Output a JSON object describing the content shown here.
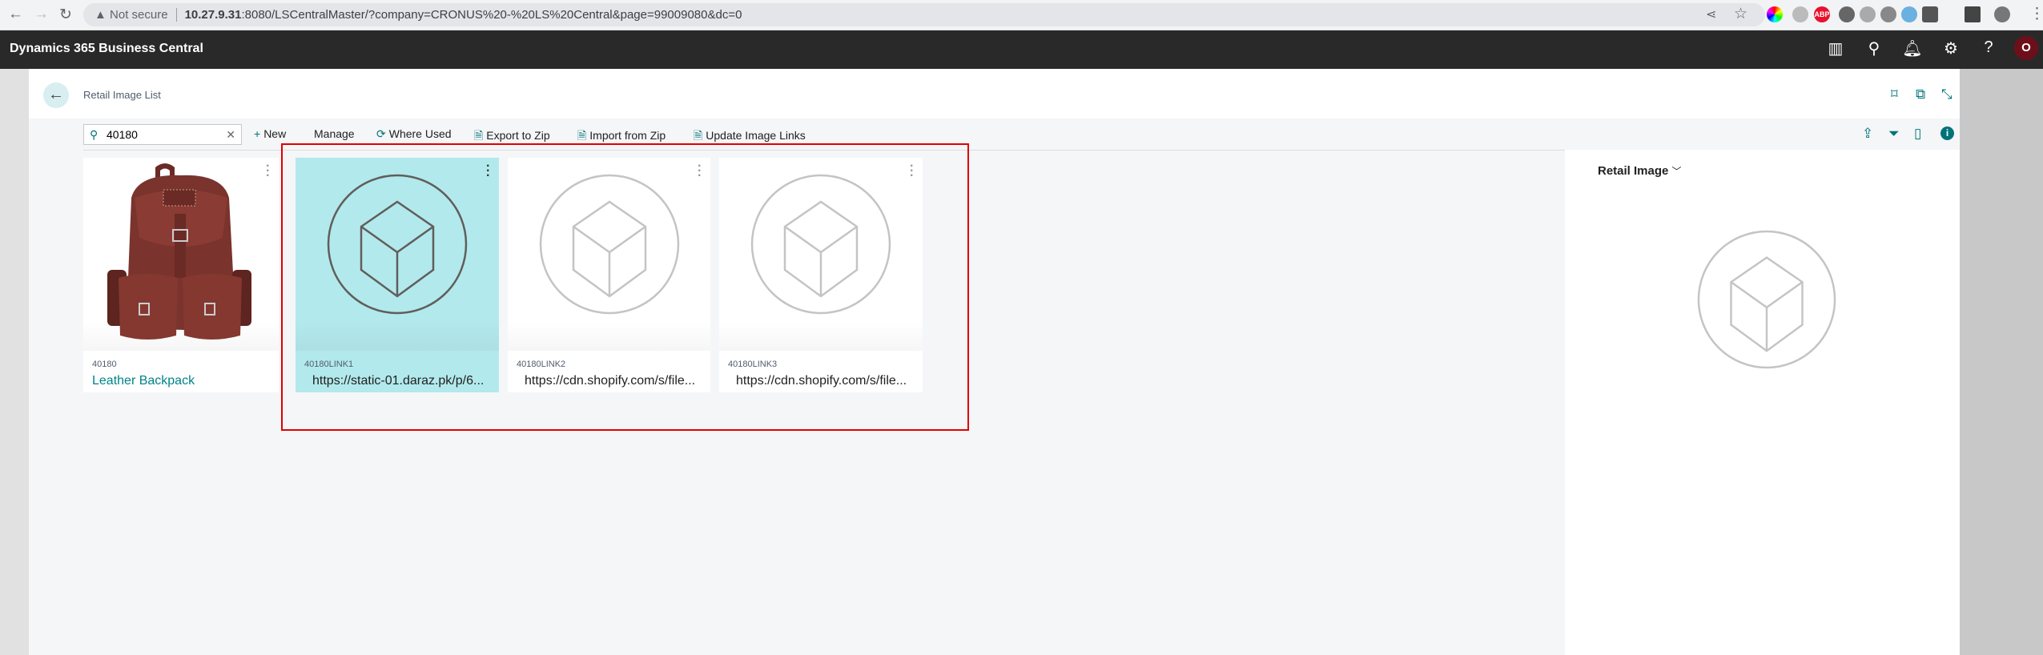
{
  "browser": {
    "not_secure": "Not secure",
    "url_host": "10.27.9.31",
    "url_rest": ":8080/LSCentralMaster/?company=CRONUS%20-%20LS%20Central&page=99009080&dc=0",
    "ext_abp": "ABP"
  },
  "app": {
    "title": "Dynamics 365 Business Central",
    "avatar_initial": "O"
  },
  "page": {
    "title": "Retail Image List"
  },
  "search": {
    "value": "40180"
  },
  "toolbar": {
    "new": "New",
    "manage": "Manage",
    "where_used": "Where Used",
    "export": "Export to Zip",
    "import": "Import from Zip",
    "update": "Update Image Links"
  },
  "cards": [
    {
      "code": "40180",
      "description": "Leather Backpack",
      "selected": false
    },
    {
      "code": "40180LINK1",
      "description": "https://static-01.daraz.pk/p/6...",
      "selected": true
    },
    {
      "code": "40180LINK2",
      "description": "https://cdn.shopify.com/s/file...",
      "selected": false
    },
    {
      "code": "40180LINK3",
      "description": "https://cdn.shopify.com/s/file...",
      "selected": false
    }
  ],
  "factbox": {
    "title": "Retail Image"
  },
  "colors": {
    "accent": "#00737a",
    "selected": "#b2e9ec",
    "highlight_box": "#e00000",
    "appbar": "#292929"
  }
}
